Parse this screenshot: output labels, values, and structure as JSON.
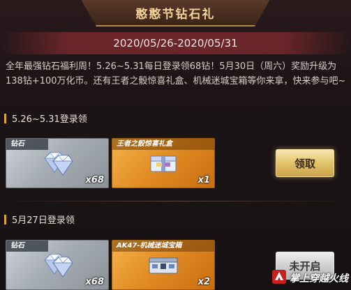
{
  "header": {
    "title": "憨憨节钻石礼",
    "date_range": "2020/05/26-2020/05/31"
  },
  "description": "全年最强钻石福利周！5.26~5.31每日登录领68钻！5月30日（周六）奖励升级为138钻+100万化币。还有王者之骰惊喜礼盒、机械迷城宝箱等你来拿，快来参与吧~",
  "sections": [
    {
      "title": "5.26~5.31登录领",
      "items": [
        {
          "label": "钻石",
          "count": "x68",
          "style": "silver",
          "icon": "diamond-icon"
        },
        {
          "label": "王者之骰惊喜礼盒",
          "count": "x1",
          "style": "gold",
          "icon": "gift-box-icon"
        }
      ],
      "button": "领取",
      "button_state": "claimable"
    },
    {
      "title": "5月27日登录领",
      "items": [
        {
          "label": "钻石",
          "count": "x68",
          "style": "silver",
          "icon": "diamond-icon"
        },
        {
          "label": "AK47-机械迷城宝箱",
          "count": "x2",
          "style": "gold",
          "icon": "treasure-box-icon"
        }
      ],
      "button": "未开启",
      "button_state": "locked"
    }
  ],
  "watermark": {
    "text": "掌上穿越火线"
  },
  "colors": {
    "accent": "#e0a430",
    "date_bar": "#7a282d",
    "title_text": "#f3d39a"
  }
}
